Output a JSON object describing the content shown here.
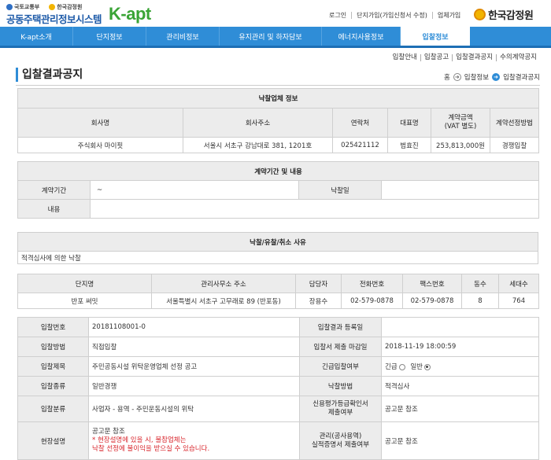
{
  "header": {
    "ministry": "국토교통부",
    "agency_small": "한국감정원",
    "site_title": "공동주택관리정보시스템",
    "logo": "K-apt",
    "links": [
      "로그인",
      "단지가입(가입신청서 수정)",
      "업체가입"
    ],
    "brand": "한국감정원",
    "colors": {
      "nav": "#2f8dd7",
      "logo_green": "#3aa436",
      "site_blue": "#1d5aa8"
    }
  },
  "nav": [
    "K-apt소개",
    "단지정보",
    "관리비정보",
    "유지관리 및 하자담보",
    "에너지사용정보",
    "입찰정보"
  ],
  "subnav": [
    "입찰안내",
    "입찰공고",
    "입찰결과공지",
    "수의계약공지"
  ],
  "page": {
    "title": "입찰결과공지",
    "breadcrumb": [
      "홈",
      "입찰정보",
      "입찰결과공지"
    ]
  },
  "winner": {
    "caption": "낙찰업체 정보",
    "headers": [
      "회사명",
      "회사주소",
      "연락처",
      "대표명",
      "계약금액\n(VAT 별도)",
      "계약선정방법"
    ],
    "row": [
      "주식회사 마이핏",
      "서울시 서초구 강남대로 381, 1201호",
      "025421112",
      "범효진",
      "253,813,000원",
      "경쟁입찰"
    ]
  },
  "contract": {
    "caption": "계약기간 및 내용",
    "period_label": "계약기간",
    "period_value": "~",
    "award_date_label": "낙찰일",
    "award_date_value": "",
    "content_label": "내용",
    "content_value": ""
  },
  "reason": {
    "caption": "낙찰/유찰/취소 사유",
    "value": "적격심사에 의한 낙찰"
  },
  "complex": {
    "headers": [
      "단지명",
      "관리사무소 주소",
      "담당자",
      "전화번호",
      "팩스번호",
      "동수",
      "세대수"
    ],
    "row": [
      "반포 써밋",
      "서울특별시 서초구 고무래로 89 (반포동)",
      "장용수",
      "02-579-0878",
      "02-579-0878",
      "8",
      "764"
    ]
  },
  "bid": {
    "no_label": "입찰번호",
    "no_value": "20181108001-0",
    "result_date_label": "입찰결과 등록일",
    "result_date_value": "",
    "method_label": "입찰방법",
    "method_value": "직접입찰",
    "deadline_label": "입찰서 제출 마감일",
    "deadline_value": "2018-11-19 18:00:59",
    "subject_label": "입찰제목",
    "subject_value": "주민공동시설 위탁운영업체 선정 공고",
    "urgent_label": "긴급입찰여부",
    "urgent_option": "긴급",
    "normal_option": "일반",
    "type_label": "입찰종류",
    "type_value": "일반경쟁",
    "award_method_label": "낙찰방법",
    "award_method_value": "적격심사",
    "category_label": "입찰분류",
    "category_value": "사업자 - 용역 - 주민운동시설의 위탁",
    "credit_label": "신용평가등급확인서\n제출여부",
    "credit_value": "공고문 참조",
    "site_label": "현장설명",
    "site_value_1": "공고문 참조",
    "site_value_2": "* 현장설명에 있을 시, 불참업체는",
    "site_value_3": "낙찰 선정에 불이익을 받으실 수 있습니다.",
    "perf_label": "관리(공사용역)\n실적증명서 제출여부",
    "perf_value": "공고문 참조"
  }
}
